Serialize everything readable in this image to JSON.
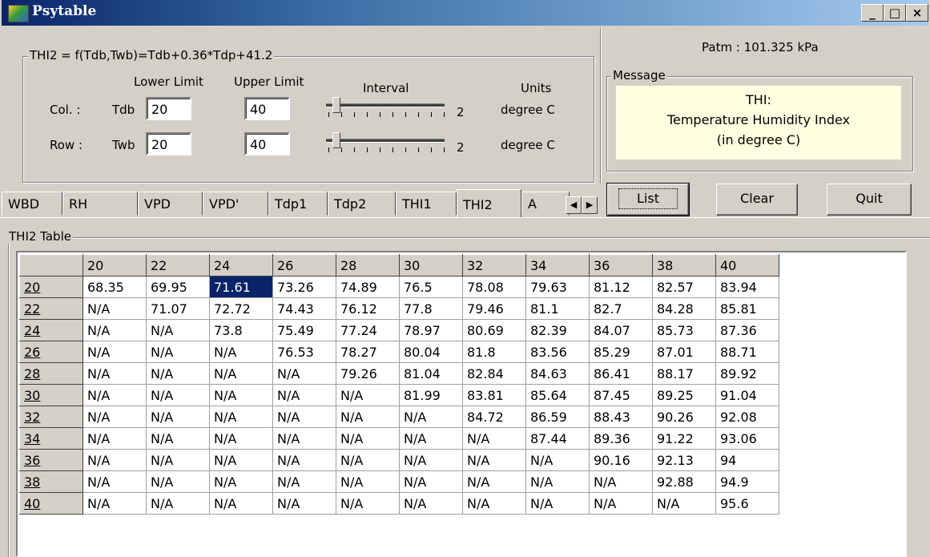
{
  "window": {
    "title": "Psytable",
    "minimize": "_",
    "maximize": "□",
    "close": "×"
  },
  "settings": {
    "legend": "THI2 = f(Tdb,Twb)=Tdb+0.36*Tdp+41.2",
    "lower_limit_label": "Lower Limit",
    "upper_limit_label": "Upper Limit",
    "interval_label": "Interval",
    "units_label": "Units",
    "col": {
      "label": "Col. :",
      "var": "Tdb",
      "lower": "20",
      "upper": "40",
      "interval": "2",
      "units": "degree C"
    },
    "row": {
      "label": "Row :",
      "var": "Twb",
      "lower": "20",
      "upper": "40",
      "interval": "2",
      "units": "degree C"
    }
  },
  "patm": "Patm : 101.325 kPa",
  "message": {
    "legend": "Message",
    "line1": "THI:",
    "line2": "Temperature Humidity Index",
    "line3": "(in degree C)"
  },
  "tabs": [
    "WBD",
    "RH",
    "VPD",
    "VPD'",
    "Tdp1",
    "Tdp2",
    "THI1",
    "THI2",
    "A"
  ],
  "active_tab": "THI2",
  "buttons": {
    "list": "List",
    "clear": "Clear",
    "quit": "Quit"
  },
  "table": {
    "legend": "THI2 Table",
    "columns": [
      "20",
      "22",
      "24",
      "26",
      "28",
      "30",
      "32",
      "34",
      "36",
      "38",
      "40"
    ],
    "rows": [
      {
        "label": "20",
        "values": [
          "68.35",
          "69.95",
          "71.61",
          "73.26",
          "74.89",
          "76.5",
          "78.08",
          "79.63",
          "81.12",
          "82.57",
          "83.94"
        ]
      },
      {
        "label": "22",
        "values": [
          "N/A",
          "71.07",
          "72.72",
          "74.43",
          "76.12",
          "77.8",
          "79.46",
          "81.1",
          "82.7",
          "84.28",
          "85.81"
        ]
      },
      {
        "label": "24",
        "values": [
          "N/A",
          "N/A",
          "73.8",
          "75.49",
          "77.24",
          "78.97",
          "80.69",
          "82.39",
          "84.07",
          "85.73",
          "87.36"
        ]
      },
      {
        "label": "26",
        "values": [
          "N/A",
          "N/A",
          "N/A",
          "76.53",
          "78.27",
          "80.04",
          "81.8",
          "83.56",
          "85.29",
          "87.01",
          "88.71"
        ]
      },
      {
        "label": "28",
        "values": [
          "N/A",
          "N/A",
          "N/A",
          "N/A",
          "79.26",
          "81.04",
          "82.84",
          "84.63",
          "86.41",
          "88.17",
          "89.92"
        ]
      },
      {
        "label": "30",
        "values": [
          "N/A",
          "N/A",
          "N/A",
          "N/A",
          "N/A",
          "81.99",
          "83.81",
          "85.64",
          "87.45",
          "89.25",
          "91.04"
        ]
      },
      {
        "label": "32",
        "values": [
          "N/A",
          "N/A",
          "N/A",
          "N/A",
          "N/A",
          "N/A",
          "84.72",
          "86.59",
          "88.43",
          "90.26",
          "92.08"
        ]
      },
      {
        "label": "34",
        "values": [
          "N/A",
          "N/A",
          "N/A",
          "N/A",
          "N/A",
          "N/A",
          "N/A",
          "87.44",
          "89.36",
          "91.22",
          "93.06"
        ]
      },
      {
        "label": "36",
        "values": [
          "N/A",
          "N/A",
          "N/A",
          "N/A",
          "N/A",
          "N/A",
          "N/A",
          "N/A",
          "90.16",
          "92.13",
          "94"
        ]
      },
      {
        "label": "38",
        "values": [
          "N/A",
          "N/A",
          "N/A",
          "N/A",
          "N/A",
          "N/A",
          "N/A",
          "N/A",
          "N/A",
          "92.88",
          "94.9"
        ]
      },
      {
        "label": "40",
        "values": [
          "N/A",
          "N/A",
          "N/A",
          "N/A",
          "N/A",
          "N/A",
          "N/A",
          "N/A",
          "N/A",
          "N/A",
          "95.6"
        ]
      }
    ],
    "selected_cell": {
      "row": 0,
      "col": 2
    }
  }
}
